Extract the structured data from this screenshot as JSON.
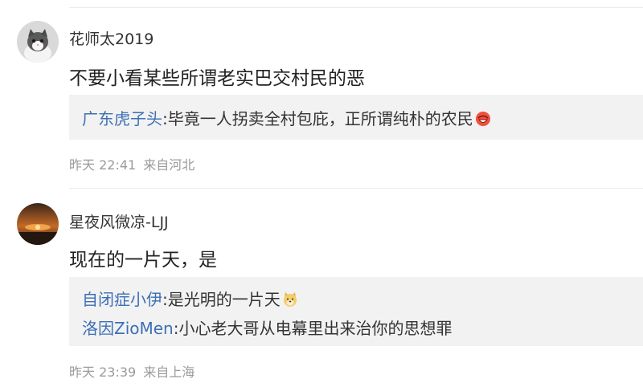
{
  "comments": [
    {
      "username": "花师太2019",
      "avatar": "cat-avatar-icon",
      "content": "不要小看某些所谓老实巴交村民的恶",
      "replies": [
        {
          "name": "广东虎子头",
          "separator": ":",
          "text": "毕竟一人拐卖全村包庇，正所谓纯朴的农民",
          "emoji": "laughing-face-emoji-icon"
        }
      ],
      "time": "昨天 22:41",
      "location": "来自河北"
    },
    {
      "username": "星夜风微凉-LJJ",
      "avatar": "sunset-avatar-icon",
      "content": "现在的一片天，是",
      "replies": [
        {
          "name": "自闭症小伊",
          "separator": ":",
          "text": "是光明的一片天",
          "emoji": "doge-emoji-icon"
        },
        {
          "name": "洛因ZioMen",
          "separator": ":",
          "text": "小心老大哥从电幕里出来治你的思想罪",
          "emoji": ""
        }
      ],
      "time": "昨天 23:39",
      "location": "来自上海"
    }
  ],
  "colors": {
    "reply_name": "#3c6fb6",
    "reply_bg": "#f2f2f2",
    "meta_text": "#9a9a9a"
  }
}
